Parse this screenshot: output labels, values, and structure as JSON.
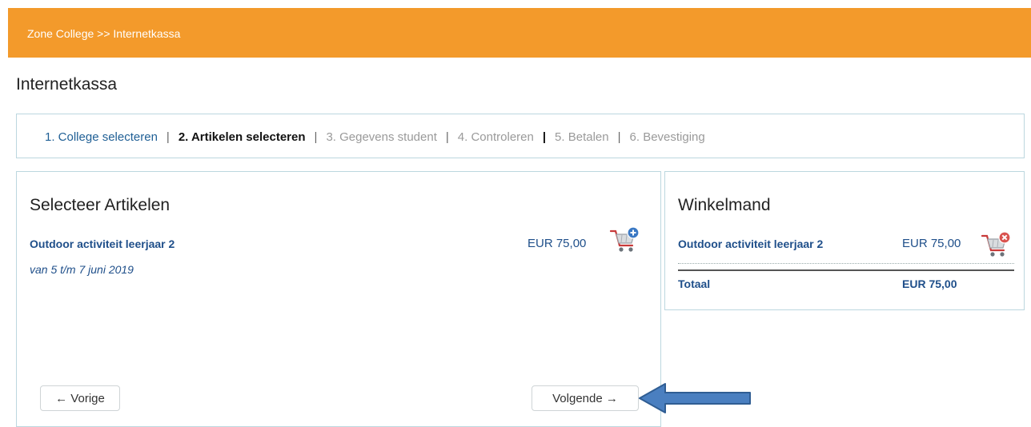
{
  "header": {
    "breadcrumb": "Zone College >> Internetkassa"
  },
  "page": {
    "title": "Internetkassa"
  },
  "steps": [
    {
      "label": "1. College selecteren",
      "state": "done"
    },
    {
      "label": "2. Artikelen selecteren",
      "state": "active"
    },
    {
      "label": "3. Gegevens student",
      "state": "pending"
    },
    {
      "label": "4. Controleren",
      "state": "pending"
    },
    {
      "label": "5. Betalen",
      "state": "pending"
    },
    {
      "label": "6. Bevestiging",
      "state": "pending"
    }
  ],
  "step_separator": "|",
  "articles": {
    "heading": "Selecteer Artikelen",
    "items": [
      {
        "title": "Outdoor activiteit leerjaar 2",
        "subtitle": "van 5 t/m 7 juni 2019",
        "price": "EUR 75,00",
        "action_icon": "cart-add-icon"
      }
    ]
  },
  "cart": {
    "heading": "Winkelmand",
    "items": [
      {
        "title": "Outdoor activiteit leerjaar 2",
        "price": "EUR 75,00",
        "action_icon": "cart-remove-icon"
      }
    ],
    "total_label": "Totaal",
    "total_value": "EUR 75,00"
  },
  "nav": {
    "prev_label": "← Vorige",
    "next_label": "Volgende →"
  },
  "colors": {
    "header": "#f39a2b",
    "link": "#1f4f8a",
    "border": "#bcd7df",
    "annotation_arrow": "#4a7fc0",
    "remove": "#d9534f",
    "add": "#3a78c4"
  }
}
